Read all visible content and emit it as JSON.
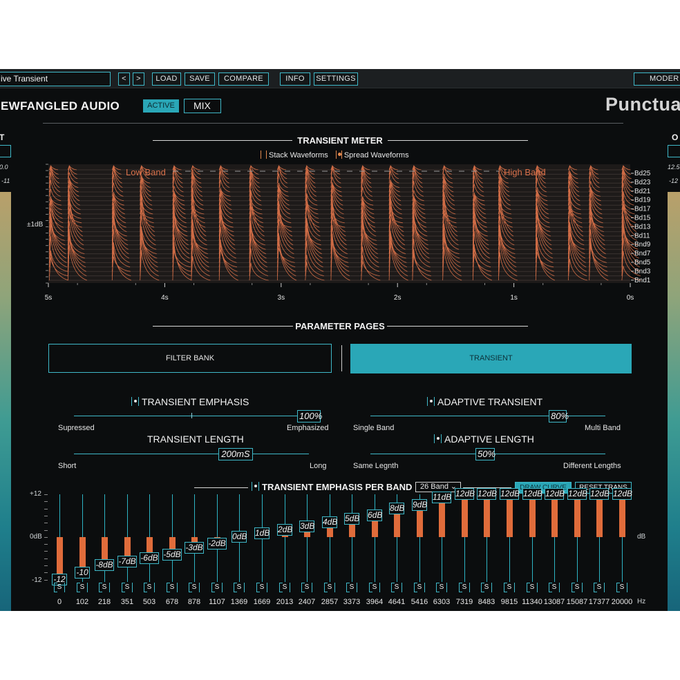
{
  "toolbar": {
    "preset": "ive Transient",
    "prev": "<",
    "next": ">",
    "load": "LOAD",
    "save": "SAVE",
    "compare": "COMPARE",
    "info": "INFO",
    "settings": "SETTINGS",
    "mode": "MODER"
  },
  "header": {
    "brand": "IEWFANGLED AUDIO",
    "active": "ACTIVE",
    "mix": "MIX",
    "plugin": "Punctua"
  },
  "input_meter": {
    "label": "T",
    "value_top": "0.0",
    "value_bot": "-11"
  },
  "output_meter": {
    "label": "O",
    "value_top": "12.5",
    "value_bot": "-12"
  },
  "transient_meter": {
    "title": "TRANSIENT METER",
    "stack_label": "Stack Waveforms",
    "spread_label": "Spread Waveforms",
    "stack_on": false,
    "spread_on": true,
    "low_band": "Low Band",
    "high_band": "High Band",
    "y_label": "±1dB",
    "band_labels": [
      "Bd25",
      "Bd23",
      "Bd21",
      "Bd19",
      "Bd17",
      "Bd15",
      "Bd13",
      "Bd11",
      "Bnd9",
      "Bnd7",
      "Bnd5",
      "Bnd3",
      "Bnd1"
    ],
    "time_labels": [
      "5s",
      "4s",
      "3s",
      "2s",
      "1s",
      "0s"
    ],
    "wave_color": "#e2744a",
    "transient_times": [
      0.06,
      0.34,
      0.52,
      0.8,
      1.12,
      1.34,
      1.6,
      1.86,
      2.06,
      2.3,
      2.56,
      2.78,
      3.02,
      3.26,
      3.52,
      3.76,
      3.92,
      4.2,
      4.44,
      4.82,
      4.98
    ]
  },
  "parameter_pages": {
    "title": "PARAMETER PAGES",
    "filter_bank": "FILTER BANK",
    "transient": "TRANSIENT"
  },
  "params": {
    "emphasis": {
      "title": "TRANSIENT EMPHASIS",
      "value": "100%",
      "fraction": 1.0,
      "min_label": "Supressed",
      "max_label": "Emphasized"
    },
    "length": {
      "title": "TRANSIENT LENGTH",
      "value": "200mS",
      "fraction": 0.62,
      "min_label": "Short",
      "max_label": "Long"
    },
    "adaptive": {
      "title": "ADAPTIVE TRANSIENT",
      "value": "80%",
      "fraction": 0.8,
      "min_label": "Single Band",
      "max_label": "Multi Band"
    },
    "adaptive_length": {
      "title": "ADAPTIVE LENGTH",
      "value": "50%",
      "fraction": 0.5,
      "min_label": "Same Legnth",
      "max_label": "Different Lengths"
    }
  },
  "per_band": {
    "title": "TRANSIENT EMPHASIS PER BAND",
    "band_count": "26 Band",
    "draw_curve": "DRAW CURVE",
    "reset": "RESET TRANS",
    "y_top": "+12",
    "y_mid": "0dB",
    "y_bot": "-12",
    "unit_db": "dB",
    "unit_hz": "Hz",
    "solo": "S",
    "bands": [
      {
        "hz": "0",
        "db": -12,
        "label": "-12"
      },
      {
        "hz": "102",
        "db": -10,
        "label": "-10"
      },
      {
        "hz": "218",
        "db": -8,
        "label": "-8dB"
      },
      {
        "hz": "351",
        "db": -7,
        "label": "-7dB"
      },
      {
        "hz": "503",
        "db": -6,
        "label": "-6dB"
      },
      {
        "hz": "678",
        "db": -5,
        "label": "-5dB"
      },
      {
        "hz": "878",
        "db": -3,
        "label": "-3dB"
      },
      {
        "hz": "1107",
        "db": -2,
        "label": "-2dB"
      },
      {
        "hz": "1369",
        "db": 0,
        "label": "0dB"
      },
      {
        "hz": "1669",
        "db": 1,
        "label": "1dB"
      },
      {
        "hz": "2013",
        "db": 2,
        "label": "2dB"
      },
      {
        "hz": "2407",
        "db": 3,
        "label": "3dB"
      },
      {
        "hz": "2857",
        "db": 4,
        "label": "4dB"
      },
      {
        "hz": "3373",
        "db": 5,
        "label": "5dB"
      },
      {
        "hz": "3964",
        "db": 6,
        "label": "6dB"
      },
      {
        "hz": "4641",
        "db": 8,
        "label": "8dB"
      },
      {
        "hz": "5416",
        "db": 9,
        "label": "9dB"
      },
      {
        "hz": "6303",
        "db": 11,
        "label": "11dB"
      },
      {
        "hz": "7319",
        "db": 12,
        "label": "12dB"
      },
      {
        "hz": "8483",
        "db": 12,
        "label": "12dB"
      },
      {
        "hz": "9815",
        "db": 12,
        "label": "12dB"
      },
      {
        "hz": "11340",
        "db": 12,
        "label": "12dB"
      },
      {
        "hz": "13087",
        "db": 12,
        "label": "12dB"
      },
      {
        "hz": "15087",
        "db": 12,
        "label": "12dB"
      },
      {
        "hz": "17377",
        "db": 12,
        "label": "12dB"
      },
      {
        "hz": "20000",
        "db": 12,
        "label": "12dB"
      }
    ]
  }
}
